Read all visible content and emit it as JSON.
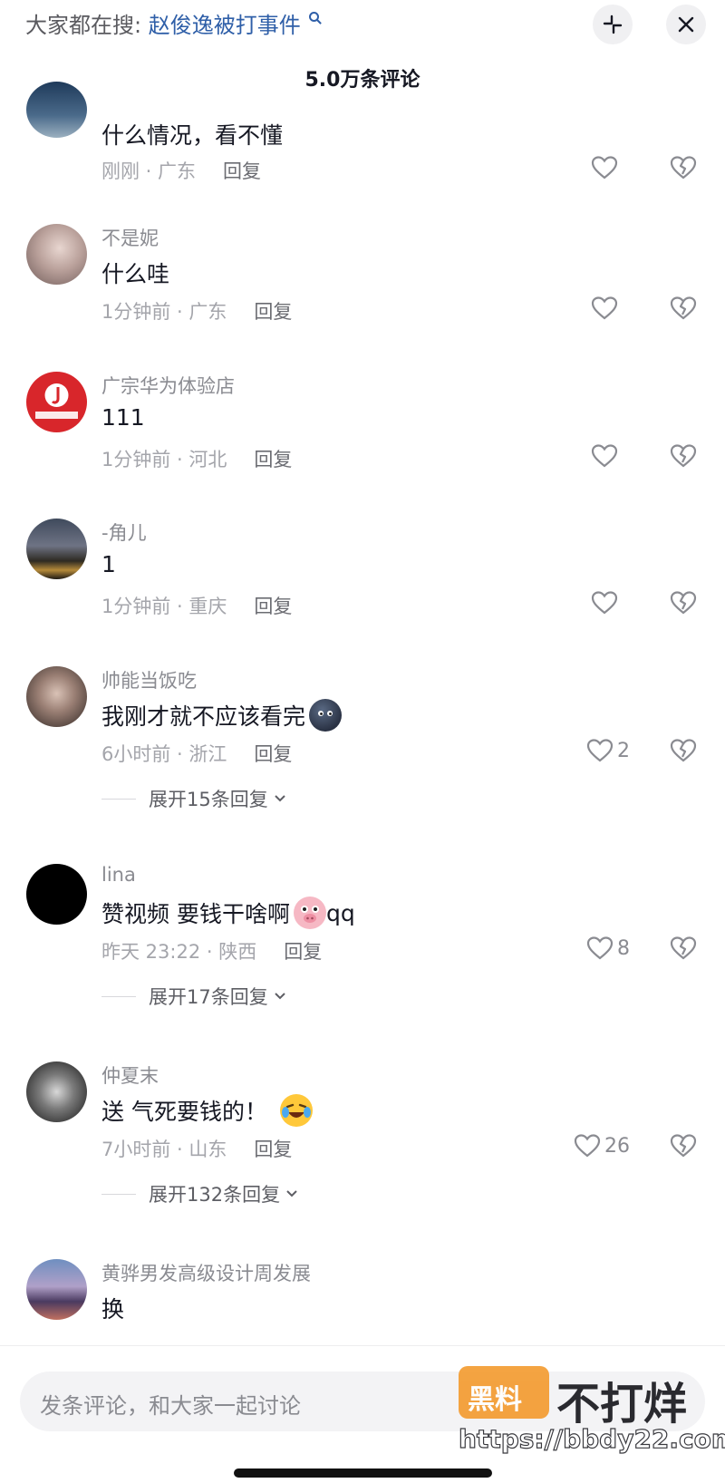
{
  "header": {
    "search_prefix": "大家都在搜:",
    "search_keyword": "赵俊逸被打事件",
    "comment_count": "5.0万条评论"
  },
  "comments": [
    {
      "username": "",
      "text": "什么情况，看不懂",
      "time_location": "刚刚 · 广东",
      "reply_label": "回复",
      "likes": ""
    },
    {
      "username": "不是妮",
      "text": "什么哇",
      "time_location": "1分钟前 · 广东",
      "reply_label": "回复",
      "likes": ""
    },
    {
      "username": "广宗华为体验店",
      "text": "111",
      "time_location": "1分钟前 · 河北",
      "reply_label": "回复",
      "likes": ""
    },
    {
      "username": "-角儿",
      "text": "1",
      "time_location": "1分钟前 · 重庆",
      "reply_label": "回复",
      "likes": ""
    },
    {
      "username": "帅能当饭吃",
      "text": "我刚才就不应该看完",
      "time_location": "6小时前 · 浙江",
      "reply_label": "回复",
      "likes": "2",
      "expand_label": "展开15条回复",
      "emoji": "black-blob-emoji"
    },
    {
      "username": "lina",
      "text": "赞视频 要钱干啥啊",
      "text_suffix": "qq",
      "time_location": "昨天 23:22 · 陕西",
      "reply_label": "回复",
      "likes": "8",
      "expand_label": "展开17条回复",
      "emoji": "pig-face-emoji"
    },
    {
      "username": "仲夏末",
      "text": "送 气死要钱的！",
      "time_location": "7小时前 · 山东",
      "reply_label": "回复",
      "likes": "26",
      "expand_label": "展开132条回复",
      "emoji": "laughing-crying-emoji"
    },
    {
      "username": "黄骅男发高级设计周发展",
      "text": "换"
    }
  ],
  "footer": {
    "input_placeholder": "发条评论，和大家一起讨论"
  },
  "watermark": {
    "box_text": "黑料",
    "text": "不打烊",
    "url": "https://bbdy22.com"
  },
  "icons": [
    "collapse-icon",
    "close-icon",
    "heart-icon",
    "broken-heart-icon",
    "chevron-down-icon"
  ],
  "colors": {
    "keyword_link": "#2f5fa8",
    "primary_text": "#161823",
    "secondary_text": "#a4a5ab",
    "watermark_orange": "#f39a2d"
  }
}
